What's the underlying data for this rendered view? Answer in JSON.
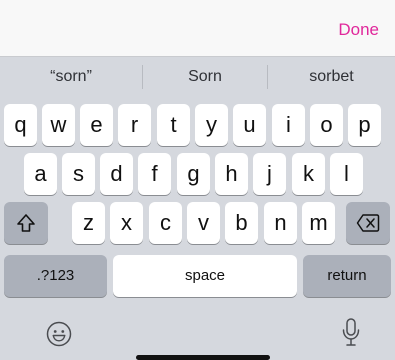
{
  "topbar": {
    "done_label": "Done"
  },
  "suggestions": [
    "“sorn”",
    "Sorn",
    "sorbet"
  ],
  "rows": {
    "row1": [
      "q",
      "w",
      "e",
      "r",
      "t",
      "y",
      "u",
      "i",
      "o",
      "p"
    ],
    "row2": [
      "a",
      "s",
      "d",
      "f",
      "g",
      "h",
      "j",
      "k",
      "l"
    ],
    "row3": [
      "z",
      "x",
      "c",
      "v",
      "b",
      "n",
      "m"
    ]
  },
  "bottom_row": {
    "numbers_label": ".?123",
    "space_label": "space",
    "return_label": "return"
  },
  "icons": {
    "shift": "shift-icon",
    "delete": "delete-icon",
    "emoji": "emoji-icon",
    "microphone": "microphone-icon"
  },
  "colors": {
    "accent": "#e0289b",
    "keyboard_bg": "#d5d8de",
    "key": "#ffffff",
    "key_dark": "#abb0ba"
  }
}
